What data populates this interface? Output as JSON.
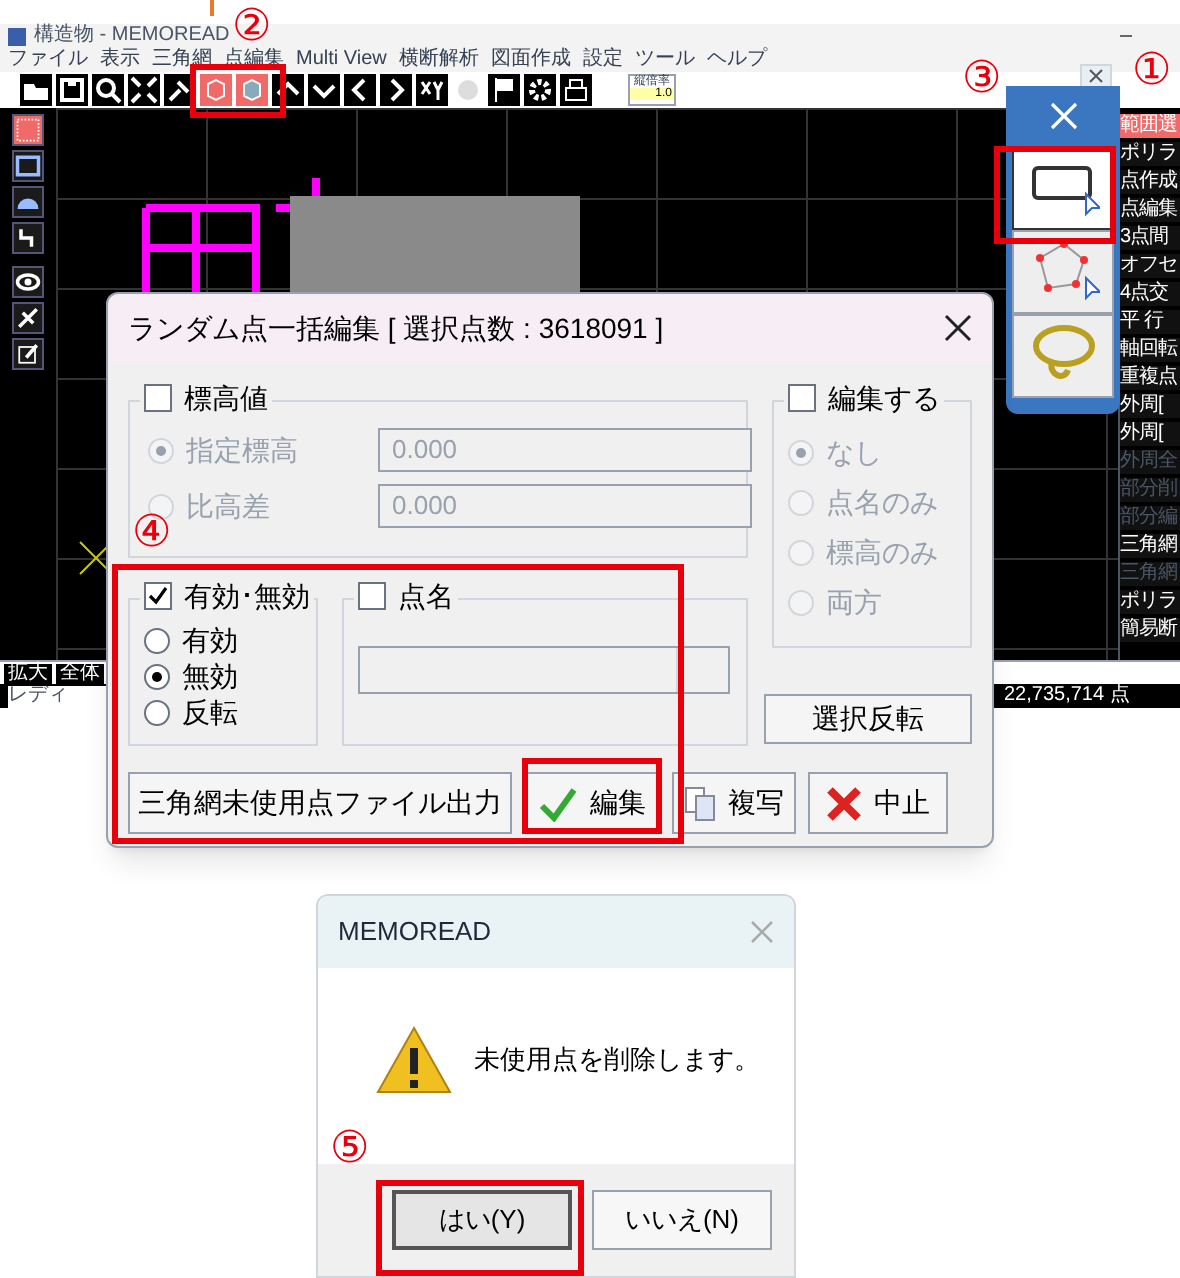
{
  "annotations": [
    {
      "label": "①"
    },
    {
      "label": "②"
    },
    {
      "label": "③"
    },
    {
      "label": "④"
    },
    {
      "label": "⑤"
    }
  ],
  "app_window": {
    "title": "構造物 - MEMOREAD",
    "menu": [
      "ファイル",
      "表示",
      "三角網",
      "点編集",
      "Multi View",
      "横断解析",
      "図面作成",
      "設定",
      "ツール",
      "ヘルプ"
    ],
    "toolbar": [
      {
        "selected": false
      },
      {
        "selected": false
      },
      {
        "selected": false
      },
      {
        "selected": false
      },
      {
        "selected": false
      },
      {
        "selected": true
      },
      {
        "selected": true
      },
      {
        "selected": false
      },
      {
        "selected": false
      },
      {
        "selected": false
      },
      {
        "selected": false
      },
      {
        "selected": false
      },
      {
        "selected": false
      },
      {
        "selected": false
      },
      {
        "selected": false
      },
      {
        "selected": false
      }
    ],
    "scale_field": {
      "label": "縦倍率",
      "value": "1.0"
    },
    "left_tools": [
      {
        "selected": true
      },
      {
        "selected": false
      },
      {
        "selected": false
      },
      {
        "selected": false
      },
      {
        "selected": false
      },
      {
        "selected": false
      },
      {
        "selected": false
      }
    ],
    "right_panel": [
      {
        "label": "範囲選",
        "selected": true,
        "disabled": false
      },
      {
        "label": "ポリラ",
        "selected": false,
        "disabled": false
      },
      {
        "label": "点作成",
        "selected": false,
        "disabled": false
      },
      {
        "label": "点編集",
        "selected": false,
        "disabled": false
      },
      {
        "label": "3点間",
        "selected": false,
        "disabled": false
      },
      {
        "label": "オフセ",
        "selected": false,
        "disabled": false
      },
      {
        "label": "4点交",
        "selected": false,
        "disabled": false
      },
      {
        "label": "平 行",
        "selected": false,
        "disabled": false
      },
      {
        "label": "軸回転",
        "selected": false,
        "disabled": false
      },
      {
        "label": "重複点",
        "selected": false,
        "disabled": false
      },
      {
        "label": "外周[",
        "selected": false,
        "disabled": false
      },
      {
        "label": "外周[",
        "selected": false,
        "disabled": false
      },
      {
        "label": "外周全",
        "selected": false,
        "disabled": true
      },
      {
        "label": "部分削",
        "selected": false,
        "disabled": true
      },
      {
        "label": "部分編",
        "selected": false,
        "disabled": true
      },
      {
        "label": "三角網",
        "selected": false,
        "disabled": false
      },
      {
        "label": "三角網",
        "selected": false,
        "disabled": true
      },
      {
        "label": "ポリラ",
        "selected": false,
        "disabled": false
      },
      {
        "label": "簡易断",
        "selected": false,
        "disabled": false
      }
    ],
    "view_buttons": [
      "拡大",
      "全体"
    ],
    "status_text": "レディ",
    "point_count": "22,735,714 点"
  },
  "tool_palette": {
    "tools": [
      {
        "kind": "rectangle",
        "selected": true
      },
      {
        "kind": "polygon",
        "selected": false
      },
      {
        "kind": "lasso",
        "selected": false
      }
    ]
  },
  "edit_dialog": {
    "title": "ランダム点一括編集 [ 選択点数 : 3618091 ]",
    "elevation_group": {
      "label": "標高値",
      "checked": false,
      "disabled": true,
      "options": [
        {
          "label": "指定標高",
          "selected": true,
          "value": "0.000"
        },
        {
          "label": "比高差",
          "selected": false,
          "value": "0.000"
        }
      ]
    },
    "edit_group": {
      "label": "編集する",
      "checked": false,
      "disabled": true,
      "options": [
        {
          "label": "なし",
          "selected": true
        },
        {
          "label": "点名のみ",
          "selected": false
        },
        {
          "label": "標高のみ",
          "selected": false
        },
        {
          "label": "両方",
          "selected": false
        }
      ]
    },
    "validity_group": {
      "label": "有効･無効",
      "checked": true,
      "options": [
        {
          "label": "有効",
          "selected": false
        },
        {
          "label": "無効",
          "selected": true
        },
        {
          "label": "反転",
          "selected": false
        }
      ]
    },
    "point_name_group": {
      "label": "点名",
      "checked": false
    },
    "invert_button": "選択反転",
    "buttons": [
      {
        "label": "三角網未使用点ファイル出力",
        "kind": "plain"
      },
      {
        "label": "編集",
        "kind": "confirm"
      },
      {
        "label": "複写",
        "kind": "copy"
      },
      {
        "label": "中止",
        "kind": "cancel"
      }
    ]
  },
  "message_box": {
    "title": "MEMOREAD",
    "message": "未使用点を削除します。",
    "buttons": [
      {
        "label": "はい(Y)",
        "default": true
      },
      {
        "label": "いいえ(N)",
        "default": false
      }
    ]
  }
}
